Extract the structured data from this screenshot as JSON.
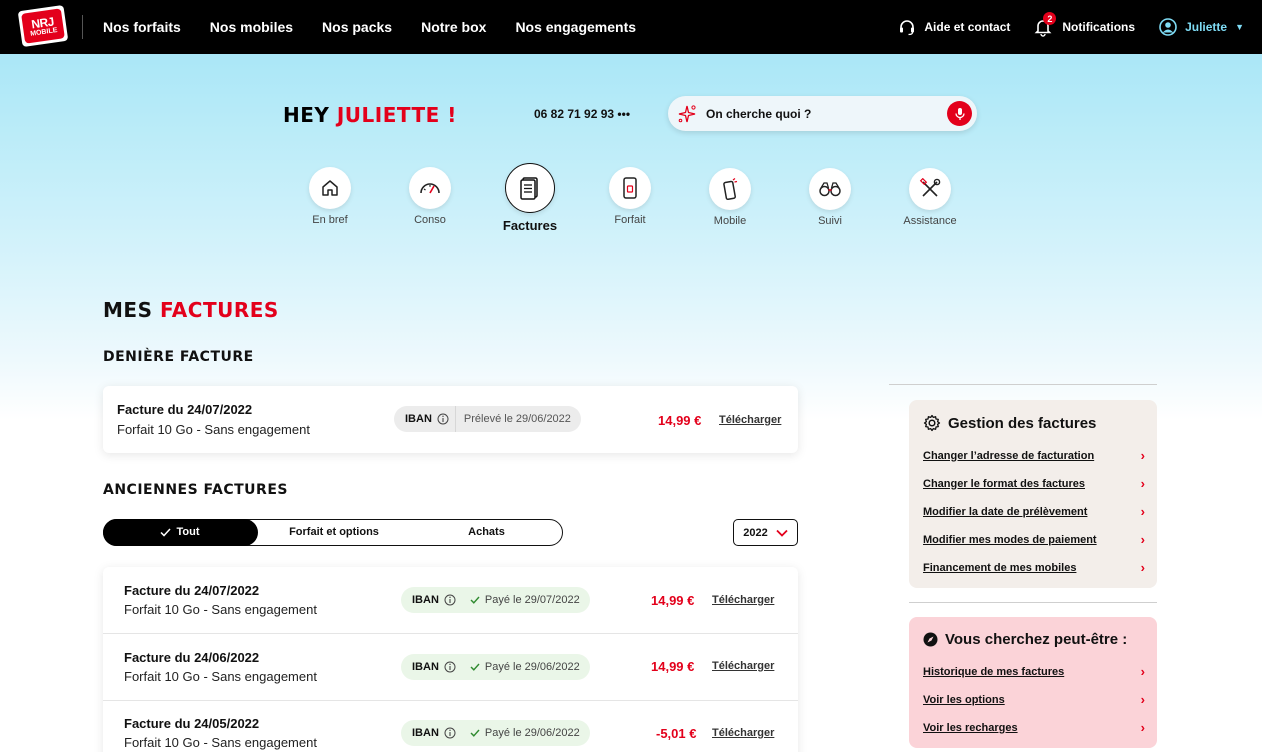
{
  "nav": {
    "logo_text": "NRJ",
    "logo_sub": "MOBILE",
    "links": [
      "Nos forfaits",
      "Nos mobiles",
      "Nos packs",
      "Notre box",
      "Nos engagements"
    ],
    "help": "Aide et contact",
    "notifications": "Notifications",
    "notif_count": "2",
    "user": "Juliette"
  },
  "greeting": {
    "hey": "HEY",
    "name": "JULIETTE !"
  },
  "phone": "06 82 71 92 93",
  "phone_more": "•••",
  "search": {
    "placeholder": "On cherche quoi ?"
  },
  "tabs": [
    {
      "label": "En bref",
      "icon": "home-icon"
    },
    {
      "label": "Conso",
      "icon": "gauge-icon"
    },
    {
      "label": "Factures",
      "icon": "invoice-icon",
      "active": true
    },
    {
      "label": "Forfait",
      "icon": "sim-phone-icon"
    },
    {
      "label": "Mobile",
      "icon": "mobile-icon"
    },
    {
      "label": "Suivi",
      "icon": "binoculars-icon"
    },
    {
      "label": "Assistance",
      "icon": "tools-icon"
    }
  ],
  "page": {
    "title_black": "MES",
    "title_red": "FACTURES",
    "last_title": "DENIÈRE FACTURE",
    "old_title": "ANCIENNES FACTURES"
  },
  "last_invoice": {
    "title": "Facture du 24/07/2022",
    "sub": "Forfait 10 Go - Sans engagement",
    "method": "IBAN",
    "status": "Prélevé le 29/06/2022",
    "amount": "14,99 €",
    "download": "Télécharger"
  },
  "filters": {
    "options": [
      "Tout",
      "Forfait et options",
      "Achats"
    ],
    "year": "2022"
  },
  "invoices": [
    {
      "title": "Facture du 24/07/2022",
      "sub": "Forfait 10 Go - Sans engagement",
      "method": "IBAN",
      "status": "Payé le 29/07/2022",
      "amount": "14,99 €",
      "download": "Télécharger"
    },
    {
      "title": "Facture du 24/06/2022",
      "sub": "Forfait 10 Go - Sans engagement",
      "method": "IBAN",
      "status": "Payé le 29/06/2022",
      "amount": "14,99 €",
      "download": "Télécharger"
    },
    {
      "title": "Facture du 24/05/2022",
      "sub": "Forfait 10 Go - Sans engagement",
      "method": "IBAN",
      "status": "Payé le 29/06/2022",
      "amount": "-5,01 €",
      "download": "Télécharger"
    }
  ],
  "gestion": {
    "title": "Gestion des factures",
    "links": [
      "Changer l’adresse de facturation",
      "Changer le format des factures",
      "Modifier la date de prélèvement",
      "Modifier mes modes de paiement",
      "Financement de mes mobiles"
    ]
  },
  "suggest": {
    "title": "Vous cherchez peut-être :",
    "links": [
      "Historique de mes factures",
      "Voir les options",
      "Voir les recharges"
    ]
  },
  "colors": {
    "brand_red": "#e3001b",
    "accent_cyan": "#7fdcf5",
    "panel_beige": "#f3eeea",
    "panel_pink": "#fbd3d8"
  }
}
